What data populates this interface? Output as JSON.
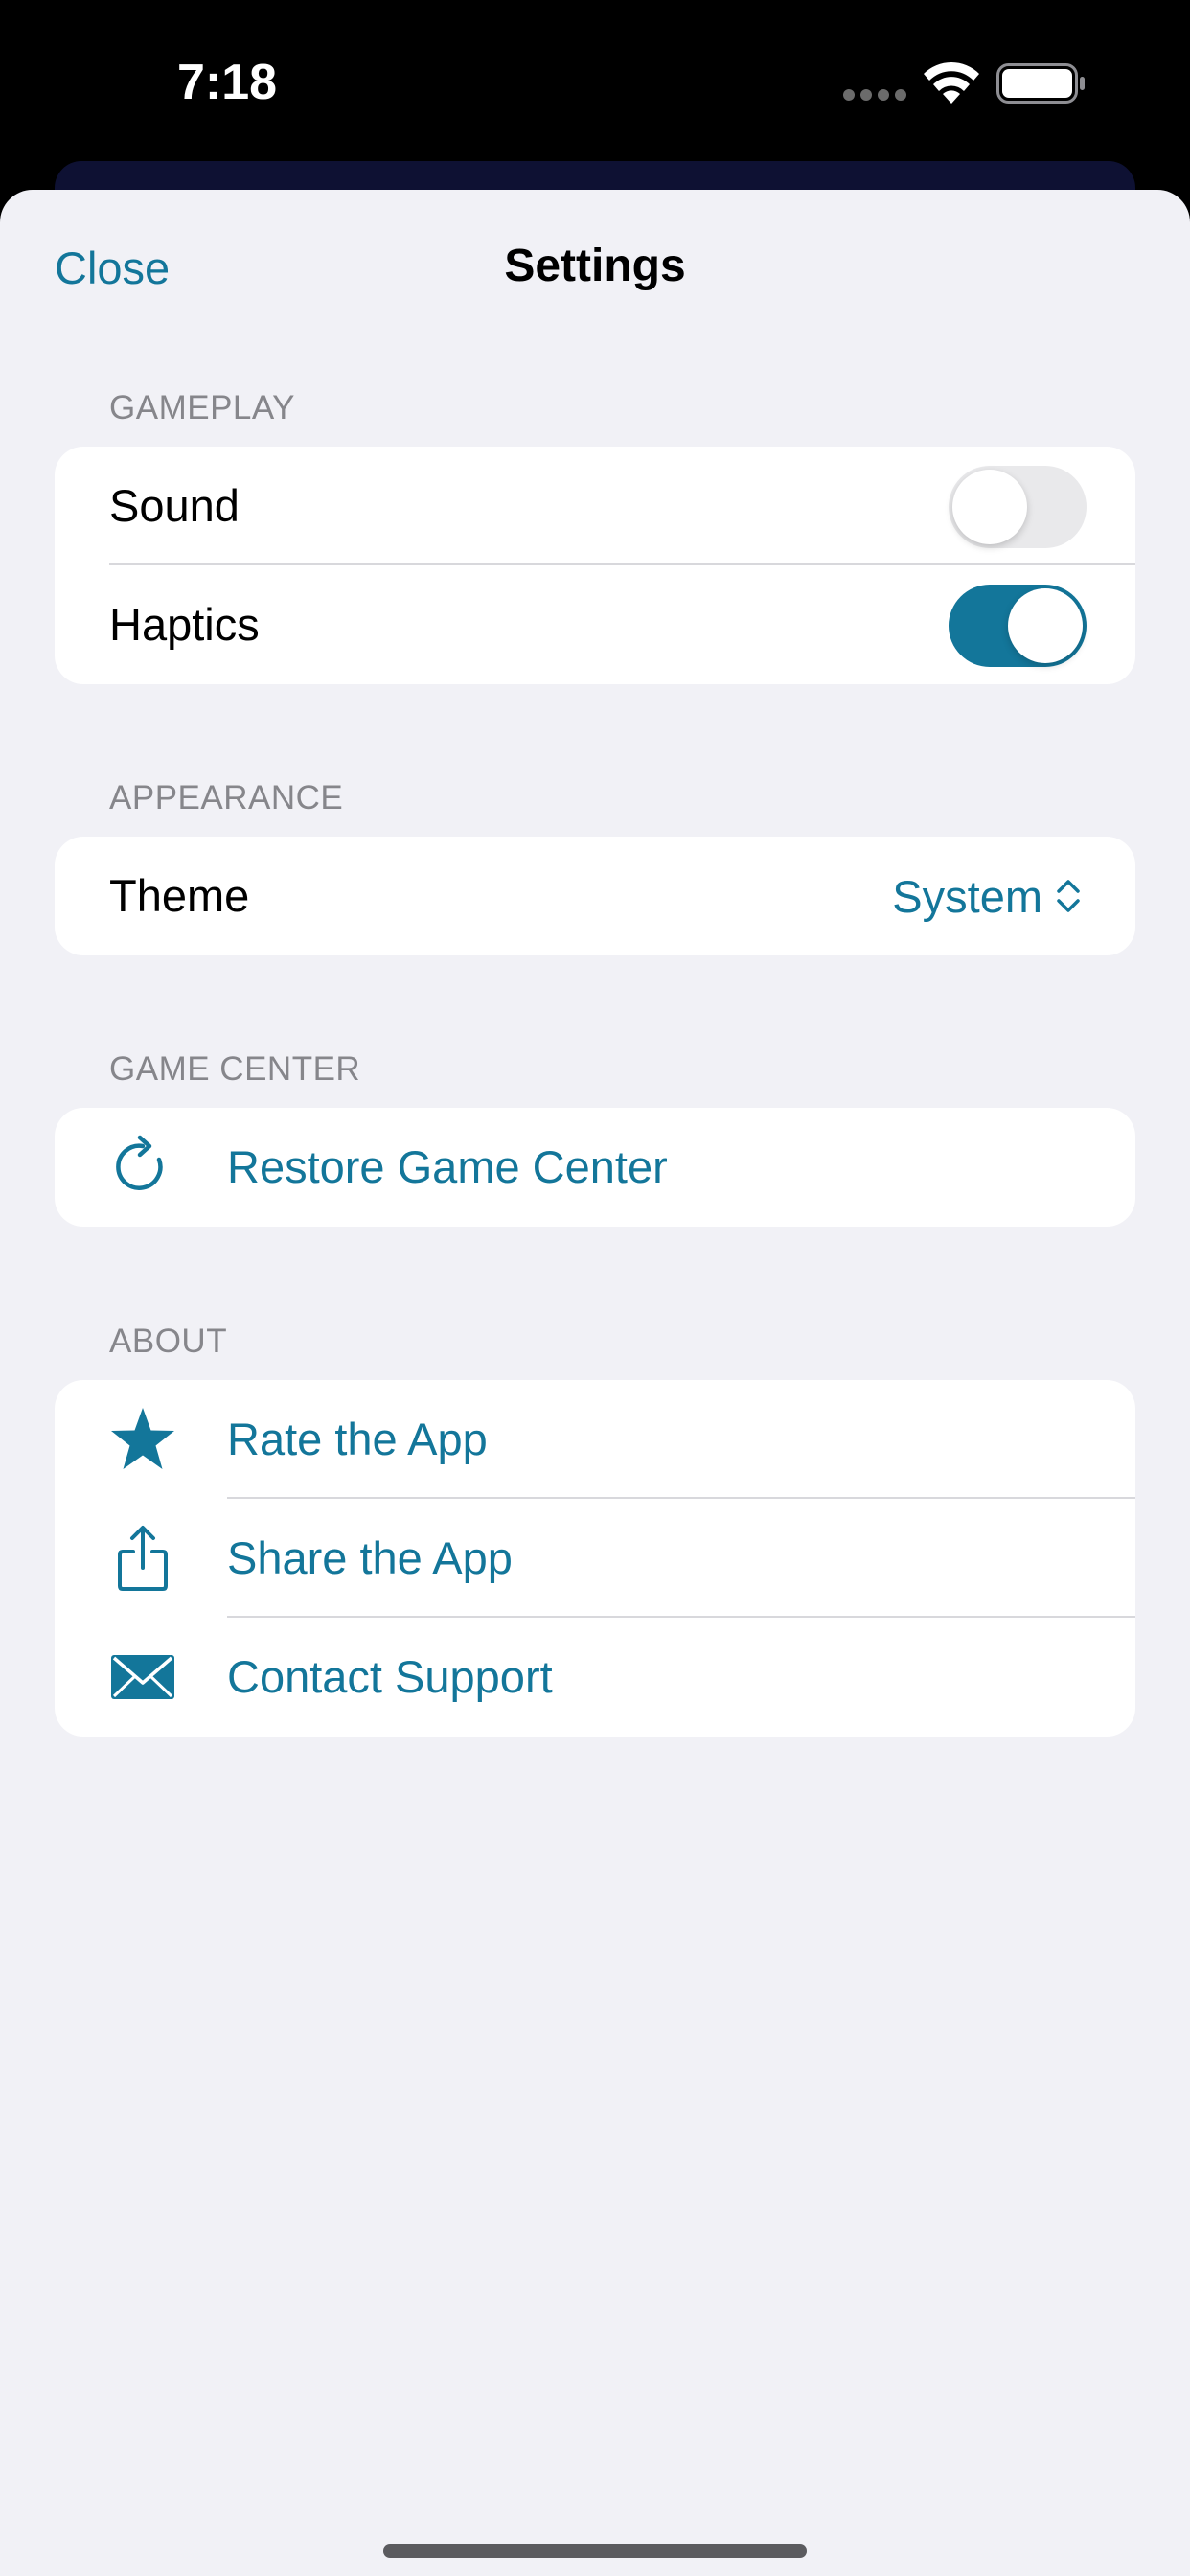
{
  "status_bar": {
    "time": "7:18",
    "icons": [
      "cellular-dots-icon",
      "wifi-icon",
      "battery-icon"
    ]
  },
  "nav": {
    "close_label": "Close",
    "title": "Settings"
  },
  "sections": {
    "gameplay": {
      "header": "GAMEPLAY",
      "sound_label": "Sound",
      "sound_on": false,
      "haptics_label": "Haptics",
      "haptics_on": true
    },
    "appearance": {
      "header": "APPEARANCE",
      "theme_label": "Theme",
      "theme_value": "System"
    },
    "game_center": {
      "header": "GAME CENTER",
      "restore_label": "Restore Game Center",
      "restore_icon": "arrow-clockwise-icon"
    },
    "about": {
      "header": "ABOUT",
      "items": [
        {
          "label": "Rate the App",
          "icon": "star-icon"
        },
        {
          "label": "Share the App",
          "icon": "share-icon"
        },
        {
          "label": "Contact Support",
          "icon": "envelope-icon"
        }
      ]
    }
  },
  "colors": {
    "accent": "#13769a",
    "background": "#f1f1f6",
    "card": "#ffffff",
    "section_header": "#86868b",
    "toggle_off": "#e9e9eb"
  }
}
